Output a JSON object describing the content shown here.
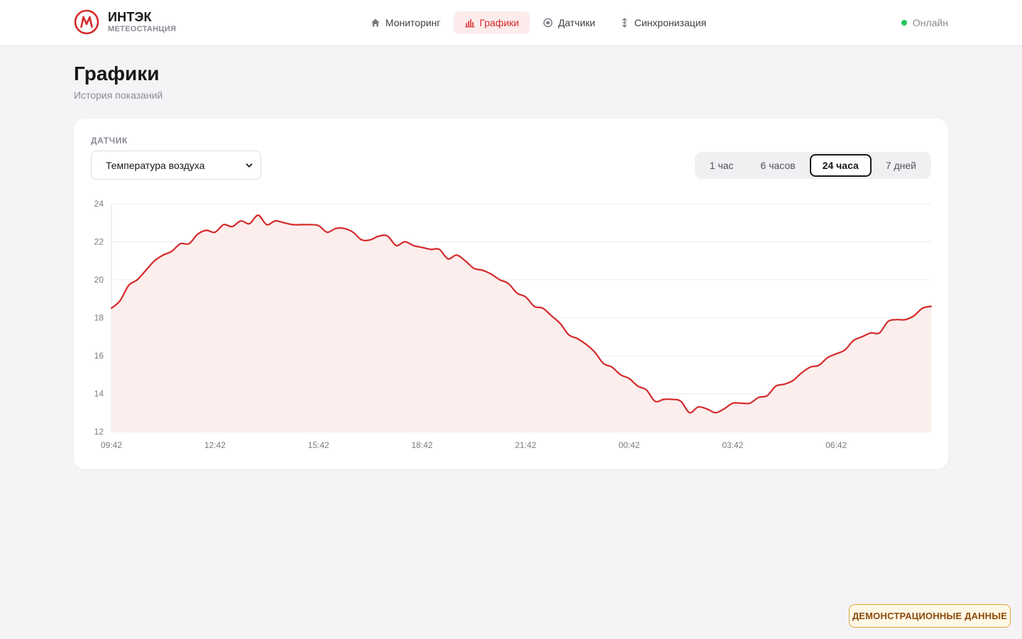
{
  "brand": {
    "name": "ИНТЭК",
    "subtitle": "МЕТЕОСТАНЦИЯ",
    "accent": "#d42a2a"
  },
  "nav": {
    "items": [
      {
        "label": "Мониторинг",
        "icon": "home-icon",
        "active": false
      },
      {
        "label": "Графики",
        "icon": "bar-chart-icon",
        "active": true
      },
      {
        "label": "Датчики",
        "icon": "sensor-icon",
        "active": false
      },
      {
        "label": "Синхронизация",
        "icon": "sync-icon",
        "active": false
      }
    ]
  },
  "status": {
    "label": "Онлайн",
    "color": "#22c55e"
  },
  "page": {
    "title": "Графики",
    "subtitle": "История показаний"
  },
  "controls": {
    "sensor_label": "ДАТЧИК",
    "sensor_value": "Температура воздуха",
    "ranges": [
      {
        "label": "1 час",
        "active": false
      },
      {
        "label": "6 часов",
        "active": false
      },
      {
        "label": "24 часа",
        "active": true
      },
      {
        "label": "7 дней",
        "active": false
      }
    ]
  },
  "chart_data": {
    "type": "area",
    "title": "",
    "xlabel": "",
    "ylabel": "",
    "ylim": [
      12,
      24
    ],
    "yticks": [
      12,
      14,
      16,
      18,
      20,
      22,
      24
    ],
    "xlim_hours": [
      0,
      23.75
    ],
    "xticks": [
      {
        "label": "09:42",
        "h": 0
      },
      {
        "label": "12:42",
        "h": 3
      },
      {
        "label": "15:42",
        "h": 6
      },
      {
        "label": "18:42",
        "h": 9
      },
      {
        "label": "21:42",
        "h": 12
      },
      {
        "label": "00:42",
        "h": 15
      },
      {
        "label": "03:42",
        "h": 18
      },
      {
        "label": "06:42",
        "h": 21
      }
    ],
    "grid": true,
    "color": "#d42a2a",
    "fill": "#fdeeee",
    "series": [
      {
        "x": [
          0,
          0.25,
          0.5,
          0.75,
          1,
          1.25,
          1.5,
          1.75,
          2,
          2.25,
          2.5,
          2.75,
          3,
          3.25,
          3.5,
          3.75,
          4,
          4.25,
          4.5,
          4.75,
          5,
          5.25,
          5.5,
          5.75,
          6,
          6.25,
          6.5,
          6.75,
          7,
          7.25,
          7.5,
          7.75,
          8,
          8.25,
          8.5,
          8.75,
          9,
          9.25,
          9.5,
          9.75,
          10,
          10.25,
          10.5,
          10.75,
          11,
          11.25,
          11.5,
          11.75,
          12,
          12.25,
          12.5,
          12.75,
          13,
          13.25,
          13.5,
          13.75,
          14,
          14.25,
          14.5,
          14.75,
          15,
          15.25,
          15.5,
          15.75,
          16,
          16.25,
          16.5,
          16.75,
          17,
          17.25,
          17.5,
          17.75,
          18,
          18.25,
          18.5,
          18.75,
          19,
          19.25,
          19.5,
          19.75,
          20,
          20.25,
          20.5,
          20.75,
          21,
          21.25,
          21.5,
          21.75,
          22,
          22.25,
          22.5,
          22.75,
          23,
          23.25,
          23.5,
          23.75
        ],
        "values": [
          18.5,
          18.9,
          19.7,
          20.0,
          20.5,
          21.0,
          21.3,
          21.5,
          21.9,
          21.9,
          22.4,
          22.6,
          22.5,
          22.9,
          22.8,
          23.1,
          22.95,
          23.4,
          22.9,
          23.1,
          23.0,
          22.9,
          22.9,
          22.9,
          22.85,
          22.5,
          22.7,
          22.7,
          22.5,
          22.1,
          22.1,
          22.3,
          22.3,
          21.8,
          22.0,
          21.8,
          21.7,
          21.6,
          21.6,
          21.1,
          21.3,
          21.0,
          20.6,
          20.5,
          20.3,
          20.0,
          19.8,
          19.3,
          19.1,
          18.6,
          18.5,
          18.1,
          17.7,
          17.1,
          16.9,
          16.6,
          16.2,
          15.6,
          15.4,
          15.0,
          14.8,
          14.4,
          14.2,
          13.6,
          13.7,
          13.7,
          13.6,
          13.0,
          13.3,
          13.2,
          13.0,
          13.2,
          13.5,
          13.5,
          13.5,
          13.8,
          13.9,
          14.4,
          14.5,
          14.7,
          15.1,
          15.4,
          15.5,
          15.9,
          16.1,
          16.3,
          16.8,
          17.0,
          17.2,
          17.2,
          17.8,
          17.9,
          17.9,
          18.1,
          18.5,
          18.6
        ]
      }
    ]
  },
  "demo_badge": {
    "label": "ДЕМОНСТРАЦИОННЫЕ ДАННЫЕ"
  }
}
